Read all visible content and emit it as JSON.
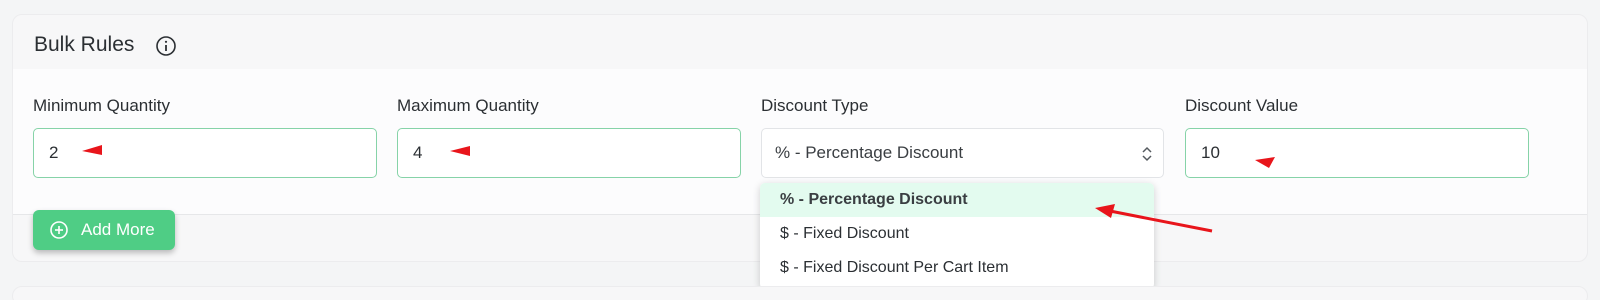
{
  "section": {
    "title": "Bulk Rules"
  },
  "fields": {
    "min_qty": {
      "label": "Minimum Quantity",
      "value": "2"
    },
    "max_qty": {
      "label": "Maximum Quantity",
      "value": "4"
    },
    "discount_type": {
      "label": "Discount Type",
      "value": "% - Percentage Discount"
    },
    "discount_value": {
      "label": "Discount Value",
      "value": "10"
    }
  },
  "add_button": {
    "label": "Add More",
    "icon": "plus-circle-icon"
  },
  "dropdown": {
    "options": [
      {
        "label": "% - Percentage Discount",
        "selected": true
      },
      {
        "label": "$ - Fixed Discount",
        "selected": false
      },
      {
        "label": "$ - Fixed Discount Per Cart Item",
        "selected": false
      }
    ]
  },
  "colors": {
    "accent": "#4fcd85",
    "input_border": "#86d3a8",
    "selected_option_bg": "#e3fbef",
    "annotation_arrow": "#e8151b"
  }
}
